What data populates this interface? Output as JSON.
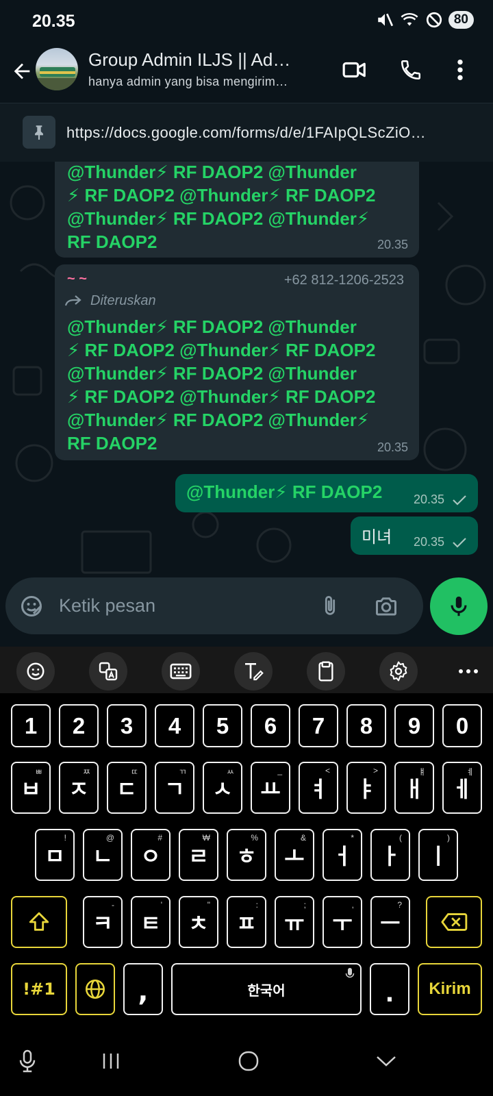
{
  "status_bar": {
    "time": "20.35",
    "battery": "80"
  },
  "header": {
    "title": "Group Admin ILJS || Ad…",
    "subtitle": "hanya admin yang bisa mengirim…"
  },
  "pinned": {
    "text": "https://docs.google.com/forms/d/e/1FAIpQLScZiO…"
  },
  "messages": [
    {
      "lines": [
        "@Thunder⚡ RF DAOP2 @Thunder",
        "⚡ RF DAOP2 @Thunder⚡ RF DAOP2",
        "@Thunder⚡ RF DAOP2 @Thunder⚡",
        "RF DAOP2"
      ],
      "time": "20.35"
    },
    {
      "sender": "~ ~",
      "phone": "+62 812-1206-2523",
      "forwarded_label": "Diteruskan",
      "lines": [
        "@Thunder⚡ RF DAOP2 @Thunder",
        "⚡ RF DAOP2 @Thunder⚡ RF DAOP2",
        "@Thunder⚡ RF DAOP2 @Thunder",
        "⚡ RF DAOP2 @Thunder⚡ RF DAOP2",
        "@Thunder⚡ RF DAOP2 @Thunder⚡",
        "RF DAOP2"
      ],
      "time": "20.35"
    },
    {
      "text": "@Thunder⚡ RF DAOP2",
      "time": "20.35"
    },
    {
      "text": "미녀",
      "time": "20.35"
    }
  ],
  "input": {
    "placeholder": "Ketik pesan"
  },
  "keyboard": {
    "numbers": [
      "1",
      "2",
      "3",
      "4",
      "5",
      "6",
      "7",
      "8",
      "9",
      "0"
    ],
    "row1": [
      {
        "k": "ㅂ",
        "h": "ㅃ"
      },
      {
        "k": "ㅈ",
        "h": "ㅉ"
      },
      {
        "k": "ㄷ",
        "h": "ㄸ"
      },
      {
        "k": "ㄱ",
        "h": "ㄲ"
      },
      {
        "k": "ㅅ",
        "h": "ㅆ"
      },
      {
        "k": "ㅛ",
        "h": "_"
      },
      {
        "k": "ㅕ",
        "h": "<"
      },
      {
        "k": "ㅑ",
        "h": ">"
      },
      {
        "k": "ㅐ",
        "h": "ㅒ"
      },
      {
        "k": "ㅔ",
        "h": "ㅖ"
      }
    ],
    "row2": [
      {
        "k": "ㅁ",
        "h": "!"
      },
      {
        "k": "ㄴ",
        "h": "@"
      },
      {
        "k": "ㅇ",
        "h": "#"
      },
      {
        "k": "ㄹ",
        "h": "₩"
      },
      {
        "k": "ㅎ",
        "h": "%"
      },
      {
        "k": "ㅗ",
        "h": "&"
      },
      {
        "k": "ㅓ",
        "h": "*"
      },
      {
        "k": "ㅏ",
        "h": "("
      },
      {
        "k": "ㅣ",
        "h": ")"
      }
    ],
    "row3": [
      {
        "k": "ㅋ",
        "h": "-"
      },
      {
        "k": "ㅌ",
        "h": "'"
      },
      {
        "k": "ㅊ",
        "h": "\""
      },
      {
        "k": "ㅍ",
        "h": ":"
      },
      {
        "k": "ㅠ",
        "h": ";"
      },
      {
        "k": "ㅜ",
        "h": ","
      },
      {
        "k": "ㅡ",
        "h": "?"
      }
    ],
    "symbols_key": "!#1",
    "comma": ",",
    "space_label": "한국어",
    "period": ".",
    "send_key": "Kirim"
  }
}
